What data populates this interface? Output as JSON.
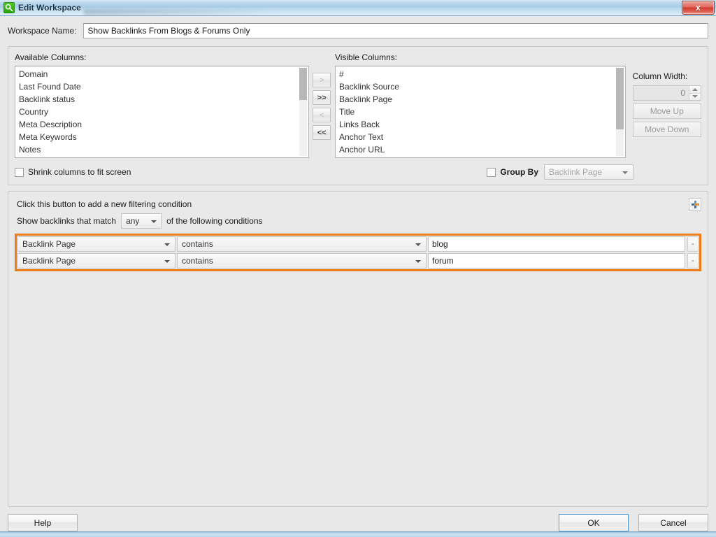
{
  "window": {
    "title": "Edit Workspace",
    "icon": "magnifier-icon",
    "close_label": "x"
  },
  "workspace": {
    "label": "Workspace Name:",
    "value": "Show Backlinks From Blogs & Forums Only",
    "placeholder": ""
  },
  "columns": {
    "available_label": "Available Columns:",
    "visible_label": "Visible Columns:",
    "available": [
      "Domain",
      "Last Found Date",
      "Backlink status",
      "Country",
      "Meta Description",
      "Meta Keywords",
      "Notes"
    ],
    "visible": [
      "#",
      "Backlink Source",
      "Backlink Page",
      "Title",
      "Links Back",
      "Anchor Text",
      "Anchor URL"
    ],
    "transfer": {
      "move_right_one": ">",
      "move_right_all": ">>",
      "move_left_one": "<",
      "move_left_all": "<<"
    },
    "width": {
      "label": "Column Width:",
      "value": "0",
      "move_up": "Move Up",
      "move_down": "Move Down"
    },
    "shrink_label": "Shrink columns to fit screen",
    "group_by_label": "Group By",
    "group_by_value": "Backlink Page"
  },
  "filters": {
    "hint": "Click this button to add a new filtering condition",
    "add_label": "+",
    "match_prefix": "Show backlinks that match",
    "match_value": "any",
    "match_suffix": "of the following conditions",
    "remove_label": "-",
    "highlight_color": "#f07c17",
    "conditions": [
      {
        "field": "Backlink Page",
        "operator": "contains",
        "value": "blog"
      },
      {
        "field": "Backlink Page",
        "operator": "contains",
        "value": "forum"
      }
    ]
  },
  "footer": {
    "help": "Help",
    "ok": "OK",
    "cancel": "Cancel"
  }
}
